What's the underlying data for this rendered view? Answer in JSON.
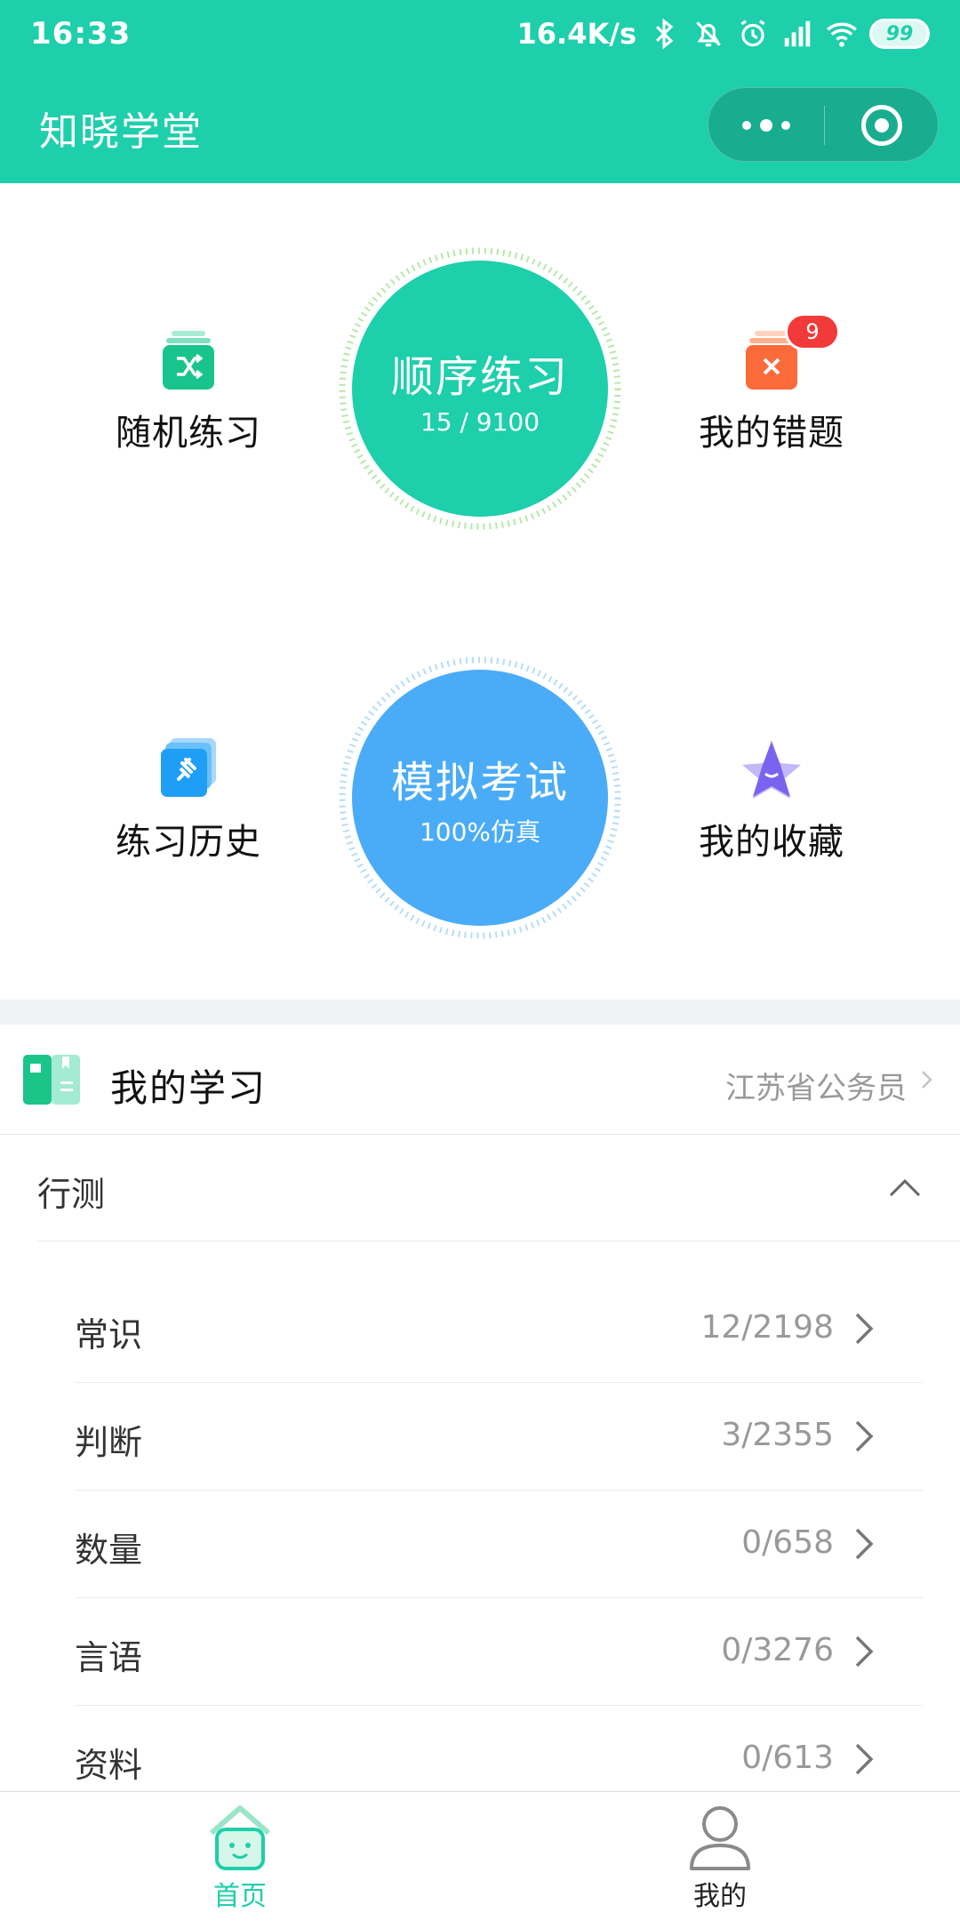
{
  "status_bar": {
    "time": "16:33",
    "net_speed": "16.4K/s",
    "battery": "99"
  },
  "header": {
    "title": "知晓学堂"
  },
  "practice": {
    "sequential": {
      "title": "顺序练习",
      "progress_text": "15 / 9100"
    },
    "mock_exam": {
      "title": "模拟考试",
      "subtitle": "100%仿真"
    },
    "random": {
      "label": "随机练习"
    },
    "wrong": {
      "label": "我的错题",
      "badge": "9"
    },
    "history": {
      "label": "练习历史"
    },
    "favorites": {
      "label": "我的收藏"
    }
  },
  "study": {
    "title": "我的学习",
    "region": "江苏省公务员"
  },
  "group": {
    "title": "行测",
    "rows": [
      {
        "name": "常识",
        "count": "12/2198"
      },
      {
        "name": "判断",
        "count": "3/2355"
      },
      {
        "name": "数量",
        "count": "0/658"
      },
      {
        "name": "言语",
        "count": "0/3276"
      },
      {
        "name": "资料",
        "count": "0/613"
      }
    ]
  },
  "tabbar": {
    "home": "首页",
    "mine": "我的"
  },
  "colors": {
    "brand_green": "#1ecfab",
    "exam_blue": "#4aacf7",
    "badge_red": "#f23a3a"
  },
  "icons": {
    "random": "shuffle-icon",
    "wrong": "cross-card-icon",
    "history": "pin-card-icon",
    "favorites": "star-icon",
    "study": "book-icon"
  }
}
